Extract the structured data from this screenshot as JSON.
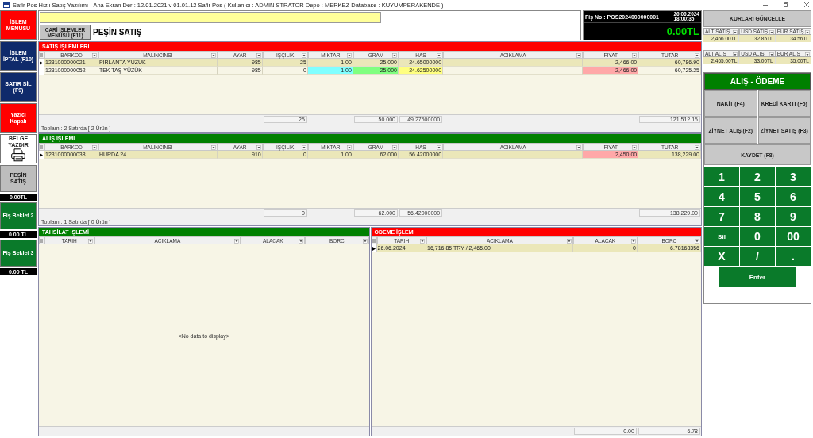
{
  "window": {
    "title": "Safir Pos Hızlı Satış Yazılımı - Ana Ekran  Der : 12.01.2021 v 01.01.12 Safir Pos  ( Kullanıcı : ADMINISTRATOR  Depo : MERKEZ  Database : KUYUMPERAKENDE )"
  },
  "sidebar": [
    {
      "kind": "button",
      "label": "İŞLEM MENÜSÜ",
      "color": "#ff0000"
    },
    {
      "kind": "button",
      "label": "İŞLEM İPTAL (F10)",
      "color": "#0f2a6b"
    },
    {
      "kind": "button",
      "label": "SATIR SİL (F9)",
      "color": "#0f2a6b"
    },
    {
      "kind": "button",
      "label": "Yazıcı Kapalı",
      "color": "#ff0000"
    },
    {
      "kind": "printer",
      "label": "BELGE YAZDIR",
      "color": "#ffffff"
    },
    {
      "kind": "button",
      "label": "PEŞİN SATIŞ",
      "color": "#bdbdbd"
    },
    {
      "kind": "amount",
      "label": "0.00TL",
      "color": "#000000"
    },
    {
      "kind": "button",
      "label": "Fiş Beklet 2",
      "color": "#0a7a2a"
    },
    {
      "kind": "amount",
      "label": "0.00 TL",
      "color": "#000000"
    },
    {
      "kind": "button",
      "label": "Fiş Beklet 3",
      "color": "#0a7a2a"
    },
    {
      "kind": "amount",
      "label": "0.00 TL",
      "color": "#000000"
    }
  ],
  "header": {
    "cari_button": "CARİ İŞLEMLER MENÜSÜ (F11)",
    "mode_title": "PEŞİN SATIŞ",
    "receipt": {
      "label": "Fiş No : POS2024000000001",
      "date": "26.06.2024",
      "time": "18:00:35",
      "total": "0.00TL"
    }
  },
  "sales": {
    "title": "SATIŞ İŞLEMLERİ",
    "color": "#ff0000",
    "columns": [
      "BARKOD",
      "MALINCINSI",
      "AYAR",
      "İŞÇİLİK",
      "MİKTAR",
      "GRAM",
      "HAS",
      "ACIKLAMA",
      "FİYAT",
      "TUTAR"
    ],
    "rows": [
      {
        "selected": true,
        "cells": [
          {
            "text": "1231000000021"
          },
          {
            "text": "PIRLANTA YÜZÜK"
          },
          {
            "text": "985"
          },
          {
            "text": "25"
          },
          {
            "text": "1.00"
          },
          {
            "text": "25.000"
          },
          {
            "text": "24.65000000"
          },
          {},
          {
            "text": "2,466.00"
          },
          {
            "text": "60,786.90"
          }
        ]
      },
      {
        "selected": false,
        "cells": [
          {
            "text": "1231000000052"
          },
          {
            "text": "TEK TAŞ YÜZÜK"
          },
          {
            "text": "985"
          },
          {
            "text": "0"
          },
          {
            "text": "1.00",
            "color": "#80ffff"
          },
          {
            "text": "25.000",
            "color": "#80ff80"
          },
          {
            "text": "24.62500000",
            "color": "#ffff80"
          },
          {},
          {
            "text": "2,466.00",
            "color": "#ffa8a8"
          },
          {
            "text": "60,725.25"
          }
        ]
      }
    ],
    "totals": [
      "25",
      "50.000",
      "49.27500000",
      "121,512.15"
    ],
    "summary": "Toplam : 2 Satırda [ 2  Ürün ]"
  },
  "purchase": {
    "title": "ALIŞ İŞLEMİ",
    "color": "#008000",
    "columns": [
      "BARKOD",
      "MALINCINSI",
      "AYAR",
      "İŞÇİLİK",
      "MİKTAR",
      "GRAM",
      "HAS",
      "ACIKLAMA",
      "FİYAT",
      "TUTAR"
    ],
    "rows": [
      {
        "selected": true,
        "cells": [
          {
            "text": "1231000000038"
          },
          {
            "text": "HURDA 24"
          },
          {
            "text": "910"
          },
          {
            "text": "0"
          },
          {
            "text": "1.00"
          },
          {
            "text": "62.000"
          },
          {
            "text": "56.42000000"
          },
          {},
          {
            "text": "2,450.00",
            "color": "#ffa8a8"
          },
          {
            "text": "138,229.00"
          }
        ]
      }
    ],
    "totals": [
      "0",
      "62.000",
      "56.42000000",
      "138,229.00"
    ],
    "summary": "Toplam : 1 Satırda [ 0  Ürün ]"
  },
  "collection": {
    "title": "TAHSİLAT İŞLEMİ",
    "color": "#008000",
    "columns": [
      "TARIH",
      "ACIKLAMA",
      "ALACAK",
      "BORC"
    ],
    "empty": "<No data to display>"
  },
  "payment": {
    "title": "ÖDEME İŞLEMİ",
    "color": "#ff0000",
    "columns": [
      "TARIH",
      "ACIKLAMA",
      "ALACAK",
      "BORC"
    ],
    "rows": [
      {
        "selected": true,
        "cells": [
          {
            "text": "26.06.2024"
          },
          {
            "text": "16,716.85 TRY / 2,465.00"
          },
          {
            "text": "0"
          },
          {
            "text": "6.78168356"
          }
        ]
      }
    ],
    "totals": [
      "0.00",
      "6.78"
    ]
  },
  "rates": {
    "button": "KURLARI GÜNCELLE",
    "groups": [
      {
        "columns": [
          "ALT SATIŞ",
          "USD SATIŞ",
          "EUR SATIŞ"
        ],
        "values": [
          "2,466.00TL",
          "32.85TL",
          "34.56TL"
        ]
      },
      {
        "columns": [
          "ALT ALIŞ",
          "USD ALIŞ",
          "EUR ALIŞ"
        ],
        "values": [
          "2,465.00TL",
          "33.00TL",
          "35.00TL"
        ]
      }
    ]
  },
  "checkout": {
    "title": "ALIŞ - ÖDEME",
    "buttons": [
      "NAKİT (F4)",
      "KREDİ KARTI (F5)",
      "ZİYNET ALIŞ (F2)",
      "ZİYNET SATIŞ (F3)"
    ],
    "save": "KAYDET  (F8)"
  },
  "keypad": {
    "keys": [
      {
        "kind": "digit",
        "label": "1"
      },
      {
        "kind": "digit",
        "label": "2"
      },
      {
        "kind": "digit",
        "label": "3"
      },
      {
        "kind": "digit",
        "label": "4"
      },
      {
        "kind": "digit",
        "label": "5"
      },
      {
        "kind": "digit",
        "label": "6"
      },
      {
        "kind": "digit",
        "label": "7"
      },
      {
        "kind": "digit",
        "label": "8"
      },
      {
        "kind": "digit",
        "label": "9"
      },
      {
        "kind": "command",
        "label": "Sil"
      },
      {
        "kind": "digit",
        "label": "0"
      },
      {
        "kind": "digit",
        "label": "00"
      },
      {
        "kind": "digit",
        "label": "X"
      },
      {
        "kind": "digit",
        "label": "/"
      },
      {
        "kind": "digit",
        "label": "."
      }
    ],
    "enter": "Enter"
  }
}
